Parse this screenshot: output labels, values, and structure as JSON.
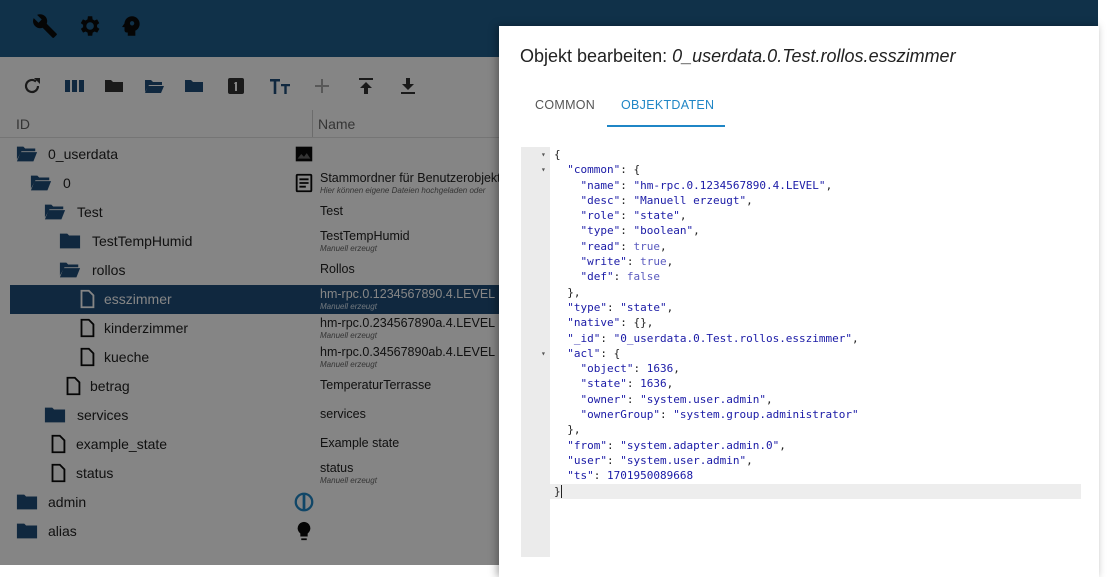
{
  "tree": {
    "column_id": "ID",
    "column_name": "Name",
    "rows": [
      {
        "label": "0_userdata",
        "name": "",
        "sub": ""
      },
      {
        "label": "0",
        "name": "Stammordner für Benutzerobjekte",
        "sub": "Hier können eigene Dateien hochgeladen oder"
      },
      {
        "label": "Test",
        "name": "Test",
        "sub": ""
      },
      {
        "label": "TestTempHumid",
        "name": "TestTempHumid",
        "sub": "Manuell erzeugt"
      },
      {
        "label": "rollos",
        "name": "Rollos",
        "sub": ""
      },
      {
        "label": "esszimmer",
        "name": "hm-rpc.0.1234567890.4.LEVEL",
        "sub": "Manuell erzeugt"
      },
      {
        "label": "kinderzimmer",
        "name": "hm-rpc.0.234567890a.4.LEVEL",
        "sub": "Manuell erzeugt"
      },
      {
        "label": "kueche",
        "name": "hm-rpc.0.34567890ab.4.LEVEL",
        "sub": "Manuell erzeugt"
      },
      {
        "label": "betrag",
        "name": "TemperaturTerrasse",
        "sub": ""
      },
      {
        "label": "services",
        "name": "services",
        "sub": ""
      },
      {
        "label": "example_state",
        "name": "Example state",
        "sub": ""
      },
      {
        "label": "status",
        "name": "status",
        "sub": "Manuell erzeugt"
      },
      {
        "label": "admin",
        "name": "",
        "sub": ""
      },
      {
        "label": "alias",
        "name": "",
        "sub": ""
      }
    ]
  },
  "dialog": {
    "title_prefix": "Objekt bearbeiten: ",
    "title_path": "0_userdata.0.Test.rollos.esszimmer",
    "tabs": [
      {
        "label": "COMMON"
      },
      {
        "label": "OBJEKTDATEN"
      }
    ],
    "code_lines": [
      "{",
      "  \"common\": {",
      "    \"name\": \"hm-rpc.0.1234567890.4.LEVEL\",",
      "    \"desc\": \"Manuell erzeugt\",",
      "    \"role\": \"state\",",
      "    \"type\": \"boolean\",",
      "    \"read\": true,",
      "    \"write\": true,",
      "    \"def\": false",
      "  },",
      "  \"type\": \"state\",",
      "  \"native\": {},",
      "  \"_id\": \"0_userdata.0.Test.rollos.esszimmer\",",
      "  \"acl\": {",
      "    \"object\": 1636,",
      "    \"state\": 1636,",
      "    \"owner\": \"system.user.admin\",",
      "    \"ownerGroup\": \"system.group.administrator\"",
      "  },",
      "  \"from\": \"system.adapter.admin.0\",",
      "  \"user\": \"system.user.admin\",",
      "  \"ts\": 1701950089668",
      "}"
    ]
  },
  "colors": {
    "appbar": "#1f5f8d",
    "selected_row": "#1f4e7a",
    "accent": "#1f86c6",
    "folder": "#1f4e7a"
  },
  "icons": {
    "appbar": [
      "wrench-icon",
      "settings-icon",
      "expert-mode-icon"
    ],
    "toolbar": [
      "refresh-icon",
      "columns-icon",
      "folder-closed-icon",
      "folder-open-icon",
      "folder-icon",
      "number-icon",
      "text-size-icon",
      "add-icon",
      "upload-icon",
      "download-icon"
    ]
  }
}
